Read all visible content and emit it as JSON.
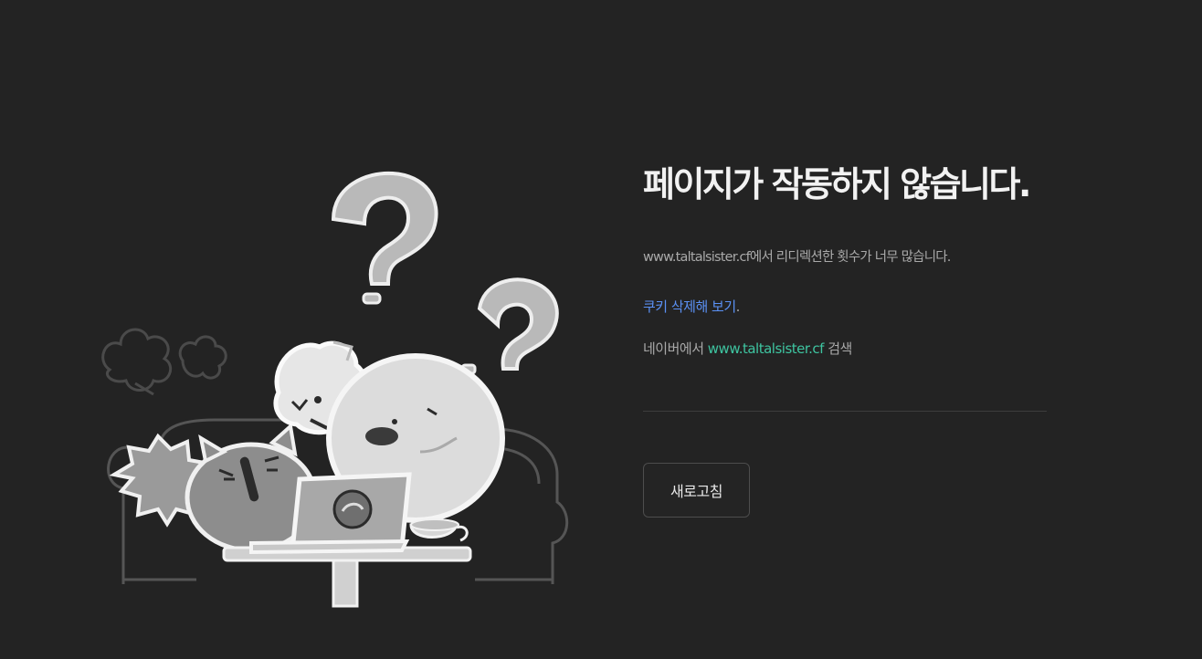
{
  "error": {
    "title": "페이지가 작동하지 않습니다.",
    "description": "www.taltalsister.cf에서 리디렉션한 횟수가 너무 많습니다.",
    "cookie_link": "쿠키 삭제해 보기",
    "cookie_suffix": ".",
    "search_prefix": "네이버에서 ",
    "search_domain": "www.taltalsister.cf",
    "search_suffix": " 검색",
    "refresh_label": "새로고침"
  },
  "colors": {
    "background": "#232323",
    "title": "#f2f2f2",
    "body_text": "#a9a9a9",
    "link_blue": "#5b91f5",
    "link_green": "#3ec4a0"
  },
  "icons": {
    "illustration": "confused-characters-laptop-illustration"
  }
}
